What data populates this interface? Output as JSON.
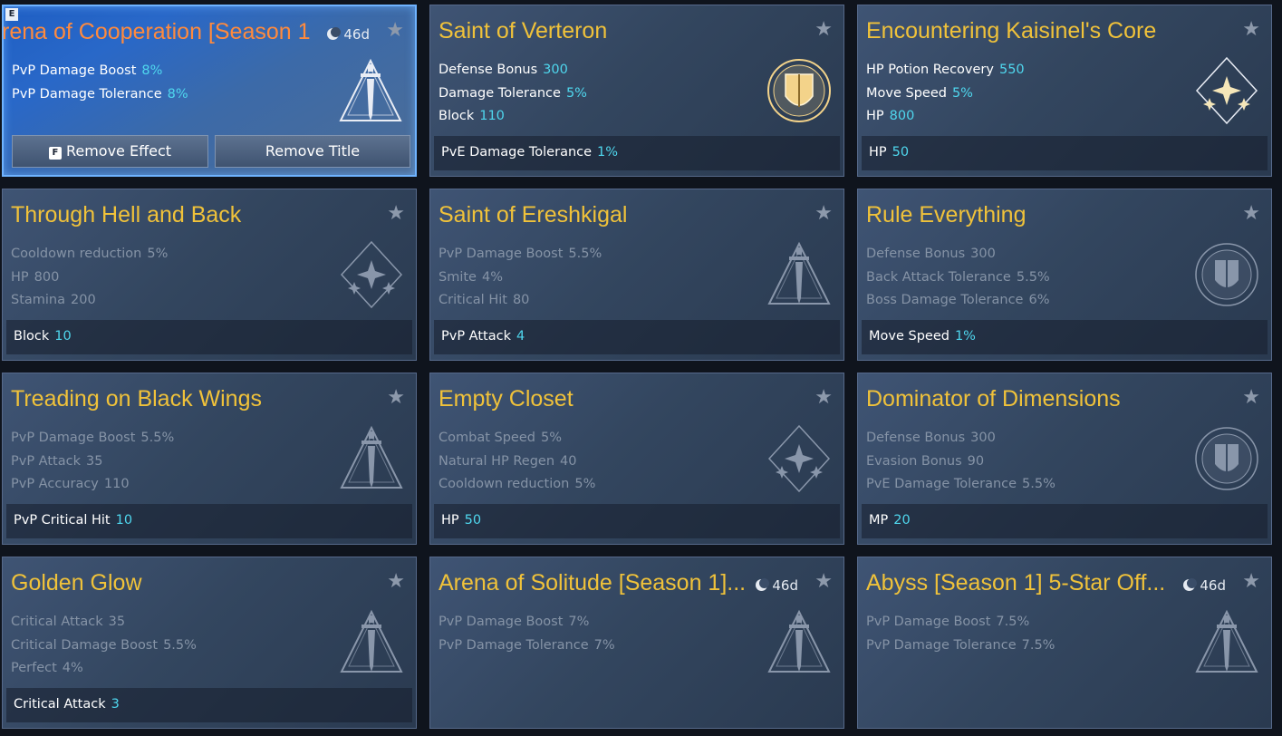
{
  "corner_key": "E",
  "cards": [
    {
      "title": "rena of Cooperation [Season 1",
      "duration": "46d",
      "selected": true,
      "active": true,
      "emblem": "triangle-sword",
      "stats": [
        {
          "label": "PvP Damage Boost",
          "value": "8%"
        },
        {
          "label": "PvP Damage Tolerance",
          "value": "8%"
        }
      ],
      "bonus": null,
      "buttons": {
        "effect_key": "F",
        "remove_effect": "Remove Effect",
        "remove_title": "Remove Title"
      }
    },
    {
      "title": "Saint of Verteron",
      "duration": "",
      "active": true,
      "emblem": "gold-shield",
      "stats": [
        {
          "label": "Defense Bonus",
          "value": "300"
        },
        {
          "label": "Damage Tolerance",
          "value": "5%"
        },
        {
          "label": "Block",
          "value": "110"
        }
      ],
      "bonus": {
        "label": "PvE Damage Tolerance",
        "value": "1%"
      }
    },
    {
      "title": "Encountering Kaisinel's Core",
      "duration": "",
      "active": true,
      "emblem": "diamond-star",
      "stats": [
        {
          "label": "HP Potion Recovery",
          "value": "550"
        },
        {
          "label": "Move Speed",
          "value": "5%"
        },
        {
          "label": "HP",
          "value": "800"
        }
      ],
      "bonus": {
        "label": "HP",
        "value": "50"
      }
    },
    {
      "title": "Through Hell and Back",
      "duration": "",
      "active": false,
      "emblem": "diamond-star",
      "stats": [
        {
          "label": "Cooldown reduction",
          "value": "5%"
        },
        {
          "label": "HP",
          "value": "800"
        },
        {
          "label": "Stamina",
          "value": "200"
        }
      ],
      "bonus": {
        "label": "Block",
        "value": "10"
      }
    },
    {
      "title": "Saint of Ereshkigal",
      "duration": "",
      "active": false,
      "emblem": "triangle-sword",
      "stats": [
        {
          "label": "PvP Damage Boost",
          "value": "5.5%"
        },
        {
          "label": "Smite",
          "value": "4%"
        },
        {
          "label": "Critical Hit",
          "value": "80"
        }
      ],
      "bonus": {
        "label": "PvP Attack",
        "value": "4"
      }
    },
    {
      "title": "Rule Everything",
      "duration": "",
      "active": false,
      "emblem": "round-shield",
      "stats": [
        {
          "label": "Defense Bonus",
          "value": "300"
        },
        {
          "label": "Back Attack Tolerance",
          "value": "5.5%"
        },
        {
          "label": "Boss Damage Tolerance",
          "value": "6%"
        }
      ],
      "bonus": {
        "label": "Move Speed",
        "value": "1%"
      }
    },
    {
      "title": "Treading on Black Wings",
      "duration": "",
      "active": false,
      "emblem": "triangle-sword",
      "stats": [
        {
          "label": "PvP Damage Boost",
          "value": "5.5%"
        },
        {
          "label": "PvP Attack",
          "value": "35"
        },
        {
          "label": "PvP Accuracy",
          "value": "110"
        }
      ],
      "bonus": {
        "label": "PvP Critical Hit",
        "value": "10"
      }
    },
    {
      "title": "Empty Closet",
      "duration": "",
      "active": false,
      "emblem": "diamond-star",
      "stats": [
        {
          "label": "Combat Speed",
          "value": "5%"
        },
        {
          "label": "Natural HP Regen",
          "value": "40"
        },
        {
          "label": "Cooldown reduction",
          "value": "5%"
        }
      ],
      "bonus": {
        "label": "HP",
        "value": "50"
      }
    },
    {
      "title": "Dominator of Dimensions",
      "duration": "",
      "active": false,
      "emblem": "round-shield",
      "stats": [
        {
          "label": "Defense Bonus",
          "value": "300"
        },
        {
          "label": "Evasion Bonus",
          "value": "90"
        },
        {
          "label": "PvE Damage Tolerance",
          "value": "5.5%"
        }
      ],
      "bonus": {
        "label": "MP",
        "value": "20"
      }
    },
    {
      "title": "Golden Glow",
      "duration": "",
      "active": false,
      "emblem": "triangle-sword",
      "stats": [
        {
          "label": "Critical Attack",
          "value": "35"
        },
        {
          "label": "Critical Damage Boost",
          "value": "5.5%"
        },
        {
          "label": "Perfect",
          "value": "4%"
        }
      ],
      "bonus": {
        "label": "Critical Attack",
        "value": "3"
      }
    },
    {
      "title": "Arena of Solitude [Season 1]...",
      "duration": "46d",
      "active": false,
      "emblem": "triangle-sword",
      "stats": [
        {
          "label": "PvP Damage Boost",
          "value": "7%"
        },
        {
          "label": "PvP Damage Tolerance",
          "value": "7%"
        }
      ],
      "bonus": null
    },
    {
      "title": "Abyss [Season 1] 5-Star Off...",
      "duration": "46d",
      "active": false,
      "emblem": "triangle-sword",
      "stats": [
        {
          "label": "PvP Damage Boost",
          "value": "7.5%"
        },
        {
          "label": "PvP Damage Tolerance",
          "value": "7.5%"
        }
      ],
      "bonus": null
    }
  ]
}
